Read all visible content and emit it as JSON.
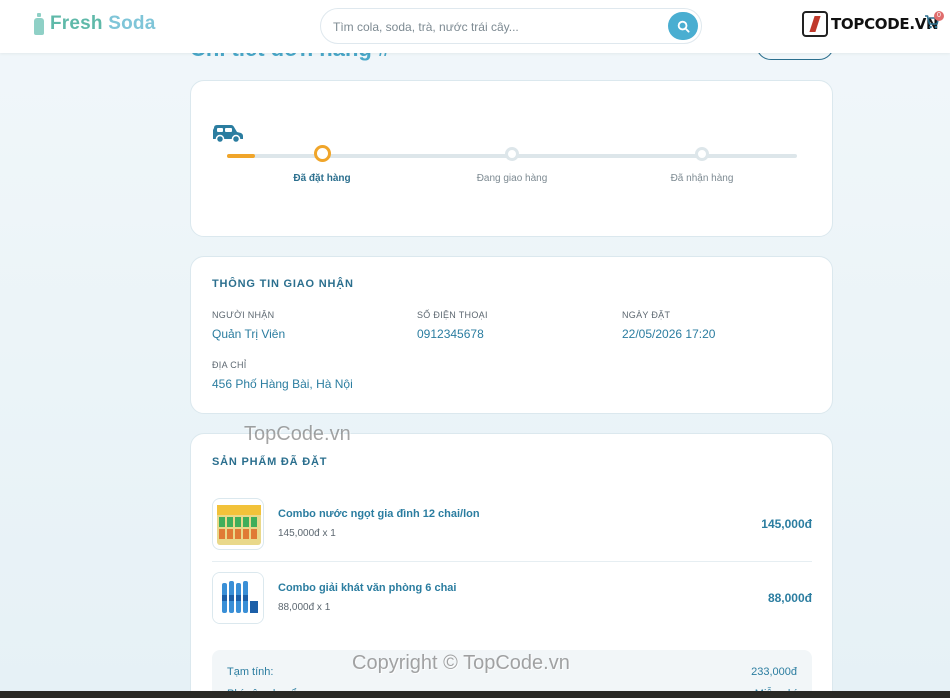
{
  "header": {
    "logo_text": "Fresh",
    "logo_text_accent": "Soda",
    "search_placeholder": "Tìm cola, soda, trà, nước trái cây...",
    "brand": "TOPCODE.VN",
    "cart_count": "0"
  },
  "page": {
    "title": "Chi tiết đơn hàng #",
    "back_label": ""
  },
  "progress": {
    "steps": [
      {
        "label": "Đã đặt hàng",
        "status": "active"
      },
      {
        "label": "Đang giao hàng",
        "status": "pending"
      },
      {
        "label": "Đã nhận hàng",
        "status": "pending"
      }
    ]
  },
  "delivery": {
    "section_title": "THÔNG TIN GIAO NHẬN",
    "recipient_label": "NGƯỜI NHẬN",
    "recipient": "Quản Trị Viên",
    "phone_label": "SỐ ĐIỆN THOẠI",
    "phone": "0912345678",
    "date_label": "NGÀY ĐẶT",
    "date": "22/05/2026 17:20",
    "address_label": "ĐỊA CHỈ",
    "address": "456 Phố Hàng Bài, Hà Nội"
  },
  "products": {
    "section_title": "SẢN PHẨM ĐÃ ĐẶT",
    "items": [
      {
        "name": "Combo nước ngọt gia đình 12 chai/lon",
        "qty": "145,000đ x 1",
        "price": "145,000đ"
      },
      {
        "name": "Combo giải khát văn phòng 6 chai",
        "qty": "88,000đ x 1",
        "price": "88,000đ"
      }
    ],
    "subtotal_label": "Tạm tính:",
    "subtotal": "233,000đ",
    "shipping_label": "Phí vận chuyển:",
    "shipping": "Miễn phí"
  },
  "watermarks": {
    "wm1": "TopCode.vn",
    "wm2": "Copyright © TopCode.vn"
  },
  "colors": {
    "accent": "#4aaed1",
    "brand_green": "#5fb9a9",
    "text_primary": "#2b7da0",
    "progress_active": "#f0a52a"
  }
}
